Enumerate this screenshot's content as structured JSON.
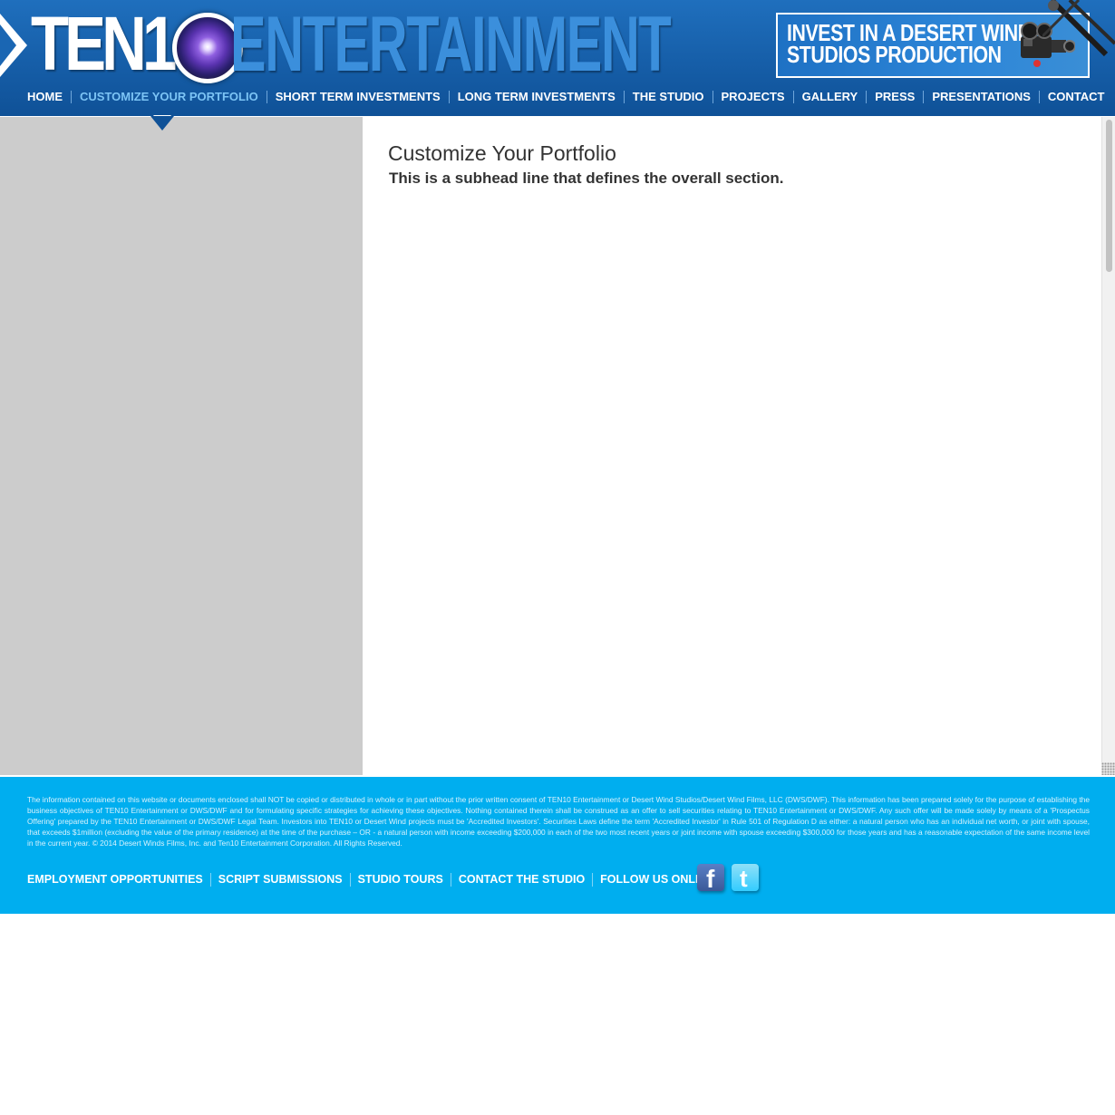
{
  "brand": {
    "logo_part1": "TEN1",
    "logo_part2": "ENTERTAINMENT",
    "promo_line1": "INVEST IN A DESERT WIND",
    "promo_line2": "STUDIOS PRODUCTION"
  },
  "nav": {
    "items": [
      {
        "label": "HOME"
      },
      {
        "label": "CUSTOMIZE YOUR PORTFOLIO",
        "active": true
      },
      {
        "label": "SHORT TERM INVESTMENTS"
      },
      {
        "label": "LONG TERM INVESTMENTS"
      },
      {
        "label": "THE STUDIO"
      },
      {
        "label": "PROJECTS"
      },
      {
        "label": "GALLERY"
      },
      {
        "label": "PRESS"
      },
      {
        "label": "PRESENTATIONS"
      },
      {
        "label": "CONTACT"
      }
    ]
  },
  "main": {
    "title": "Customize Your Portfolio",
    "subhead": "This is a subhead line that defines the overall section."
  },
  "footer": {
    "disclaimer": "The information contained on this website or documents enclosed shall NOT be copied or distributed in whole or in part without the prior written consent of TEN10 Entertainment or Desert Wind Studios/Desert Wind Films, LLC (DWS/DWF).  This information has been prepared solely for the purpose of establishing the business objectives of TEN10 Entertainment or DWS/DWF and for formulating specific strategies for achieving these objectives. Nothing contained therein shall be construed as an offer to sell securities relating to TEN10 Entertainment or DWS/DWF.  Any such offer will be made solely by means of a 'Prospectus Offering' prepared by the TEN10 Entertainment or DWS/DWF Legal Team. Investors into TEN10 or Desert Wind projects must be 'Accredited Investors'. Securities Laws define the term 'Accredited Investor' in Rule 501 of Regulation D as either: a natural person who has an individual net worth, or joint with spouse, that exceeds $1million (excluding the value of the primary residence) at the time of the purchase – OR - a natural person with income exceeding $200,000 in each of the two most recent years or joint income with spouse exceeding $300,000 for those years and has a reasonable expectation of the same income level in the current year.    © 2014 Desert Winds Films, Inc. and Ten10 Entertainment Corporation. All Rights Reserved.",
    "links": [
      {
        "label": "EMPLOYMENT OPPORTUNITIES"
      },
      {
        "label": "SCRIPT SUBMISSIONS"
      },
      {
        "label": "STUDIO TOURS"
      },
      {
        "label": "CONTACT THE STUDIO"
      }
    ],
    "follow_label": "FOLLOW US ONLINE",
    "social": [
      {
        "icon": "facebook-icon",
        "glyph": "f"
      },
      {
        "icon": "twitter-icon",
        "glyph": "t"
      }
    ]
  },
  "colors": {
    "header_blue": "#165ea8",
    "nav_active": "#7cc4f5",
    "sidebar_gray": "#cccccc",
    "footer_cyan": "#00aeef"
  }
}
